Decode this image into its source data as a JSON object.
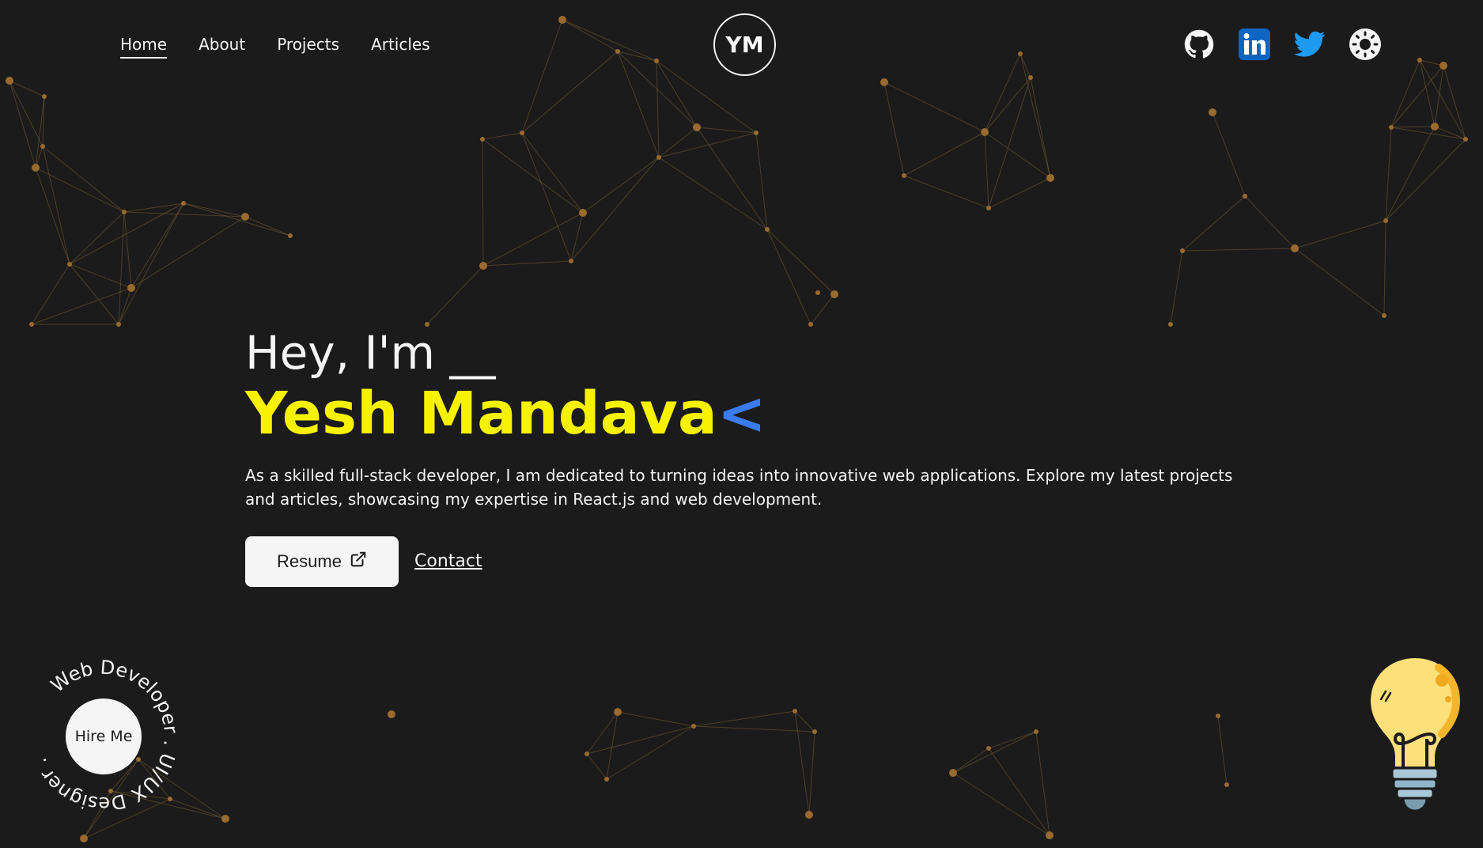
{
  "header": {
    "nav": [
      {
        "label": "Home",
        "active": true
      },
      {
        "label": "About",
        "active": false
      },
      {
        "label": "Projects",
        "active": false
      },
      {
        "label": "Articles",
        "active": false
      }
    ],
    "logo_text": "YM",
    "socials": [
      "github-icon",
      "linkedin-icon",
      "twitter-icon",
      "theme-toggle-icon"
    ]
  },
  "hero": {
    "greeting": "Hey, I'm __",
    "name": "Yesh Mandava",
    "cursor": "<",
    "intro": "As a skilled full-stack developer, I am dedicated to turning ideas into innovative web applications. Explore my latest projects and articles, showcasing my expertise in React.js and web development.",
    "resume_label": "Resume",
    "contact_label": "Contact"
  },
  "hire": {
    "button_label": "Hire Me",
    "ring_text": "Web Developer . UI/UX Designer ."
  },
  "colors": {
    "background": "#1b1b1b",
    "name_accent": "#f7f200",
    "cursor_accent": "#3a7bf0",
    "linkedin": "#0a66c2",
    "twitter": "#1d9bf0"
  }
}
